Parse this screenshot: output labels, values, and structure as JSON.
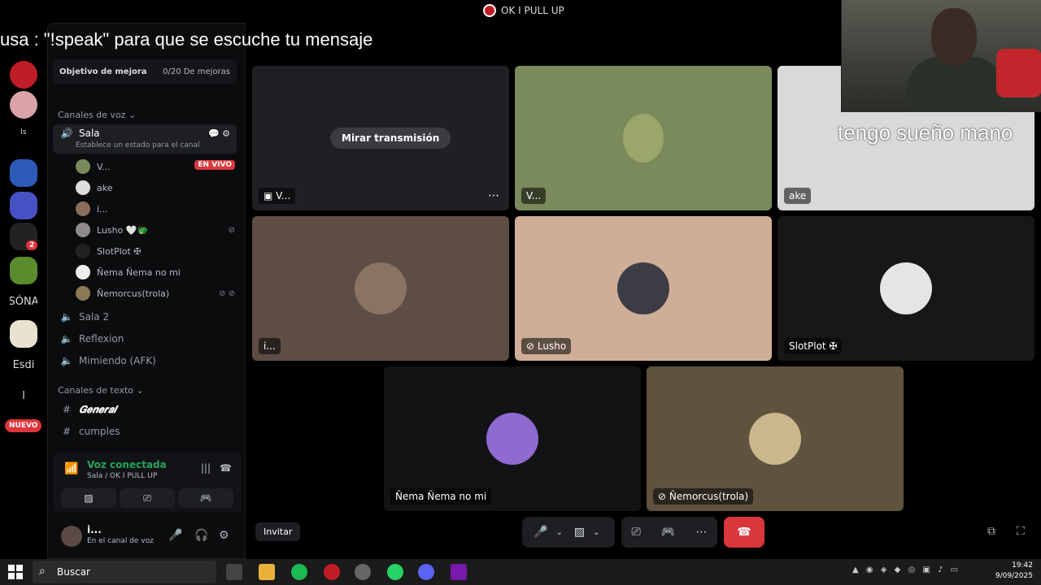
{
  "overlay_message": "usa : \"!speak\" para que se escuche tu mensaje",
  "cam_caption": "tengo sueño mano",
  "call_title": "OK I PULL UP",
  "rail": {
    "items": [
      "ls",
      "SÓNA",
      "Esdi",
      "l"
    ],
    "badge_count": "2",
    "new_badge": "NUEVO"
  },
  "sidebar": {
    "goal_title": "Objetivo de mejora",
    "goal_progress": "0/20 De mejoras",
    "voice_category": "Canales de voz",
    "active_channel": {
      "name": "Sala",
      "status_prompt": "Establece un estado para el canal"
    },
    "members": [
      {
        "name": "V...",
        "live": "EN VIVO"
      },
      {
        "name": "ake"
      },
      {
        "name": "i..."
      },
      {
        "name": "Lusho 🤍🐲"
      },
      {
        "name": "SlotPlot ✠"
      },
      {
        "name": "Ñema Ñema no mi"
      },
      {
        "name": "Ñemorcus(trola)"
      }
    ],
    "other_voice": [
      "Sala 2",
      "Reflexion",
      "Mimiendo (AFK)"
    ],
    "text_category": "Canales de texto",
    "text_channels": [
      "𝑮𝒆𝒏𝒆𝒓𝒂𝒍",
      "cumples"
    ]
  },
  "voice_connected": {
    "title": "Voz conectada",
    "subtitle": "Sala / OK I PULL UP"
  },
  "user": {
    "name": "i...",
    "status": "En el canal de voz"
  },
  "stage": {
    "watch_button": "Mirar transmisión",
    "tiles": [
      {
        "label": "V...",
        "bg": "#1f2024"
      },
      {
        "label": "V...",
        "bg": "#7a8a5b"
      },
      {
        "label": "ake",
        "bg": "#d8d9db"
      },
      {
        "label": "i...",
        "bg": "#5d4d44"
      },
      {
        "label": "Lusho",
        "bg": "#cfae98"
      },
      {
        "label": "SlotPlot ✠",
        "bg": "#161719"
      },
      {
        "label": "Ñema Ñema no mi",
        "bg": "#121315"
      },
      {
        "label": "Ñemorcus(trola)",
        "bg": "#5f533d"
      }
    ],
    "invite": "Invitar"
  },
  "taskbar": {
    "search": "Buscar",
    "time": "19:42",
    "date": "9/09/2025"
  },
  "colors": {
    "accent_green": "#23a559",
    "danger": "#da373c"
  }
}
